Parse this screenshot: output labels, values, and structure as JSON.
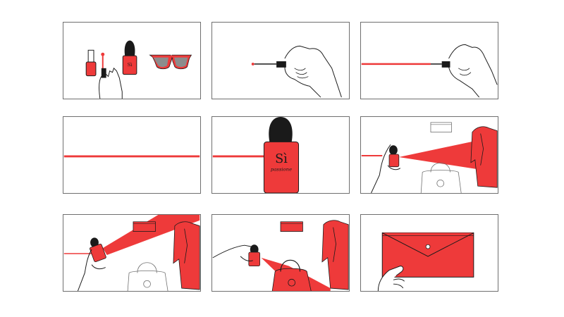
{
  "storyboard": {
    "colors": {
      "accent": "#ee3a3a",
      "ink": "#1a1a1a",
      "frame": "#6f6f6f",
      "background": "#ffffff",
      "grey_lens": "#8c8c8c"
    },
    "bottle_label": {
      "brand_mark": "Sì",
      "script_text": "passione"
    },
    "panels": [
      {
        "scene": "product-lineup",
        "icons": [
          "nail-polish-icon",
          "perfume-bottle-icon",
          "sunglasses-icon",
          "hand-icon"
        ]
      },
      {
        "scene": "brush-drawing-dot",
        "icons": [
          "hand-icon",
          "nail-brush-icon"
        ]
      },
      {
        "scene": "brush-drawing-line",
        "icons": [
          "hand-icon",
          "nail-brush-icon"
        ]
      },
      {
        "scene": "red-line",
        "icons": []
      },
      {
        "scene": "perfume-bottle-reveal",
        "icons": [
          "perfume-bottle-icon"
        ]
      },
      {
        "scene": "spray-toward-jacket",
        "icons": [
          "hand-icon",
          "perfume-bottle-icon",
          "clutch-icon",
          "handbag-icon",
          "jacket-icon"
        ]
      },
      {
        "scene": "spray-reaches-clutch",
        "icons": [
          "hand-icon",
          "perfume-bottle-icon",
          "clutch-icon",
          "handbag-icon",
          "jacket-icon"
        ]
      },
      {
        "scene": "spray-colors-handbag",
        "icons": [
          "hand-icon",
          "perfume-bottle-icon",
          "clutch-icon",
          "handbag-icon",
          "jacket-icon"
        ]
      },
      {
        "scene": "hand-holding-clutch",
        "icons": [
          "hand-icon",
          "clutch-icon"
        ]
      }
    ]
  }
}
